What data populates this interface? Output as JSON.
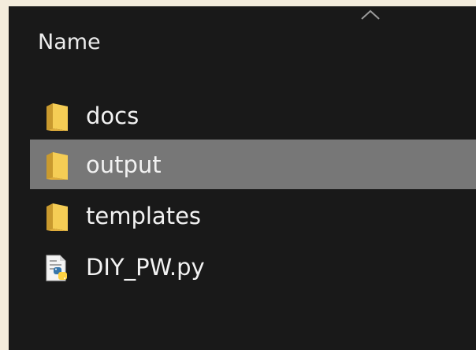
{
  "header": {
    "name_column": "Name"
  },
  "files": [
    {
      "label": "docs",
      "type": "folder",
      "selected": false,
      "icon": "folder-icon"
    },
    {
      "label": "output",
      "type": "folder",
      "selected": true,
      "icon": "folder-icon"
    },
    {
      "label": "templates",
      "type": "folder",
      "selected": false,
      "icon": "folder-icon"
    },
    {
      "label": "DIY_PW.py",
      "type": "python-file",
      "selected": false,
      "icon": "python-file-icon"
    }
  ],
  "colors": {
    "background": "#191919",
    "selected_row": "#777777",
    "folder": "#f2c94c",
    "text": "#f2f2f2"
  }
}
